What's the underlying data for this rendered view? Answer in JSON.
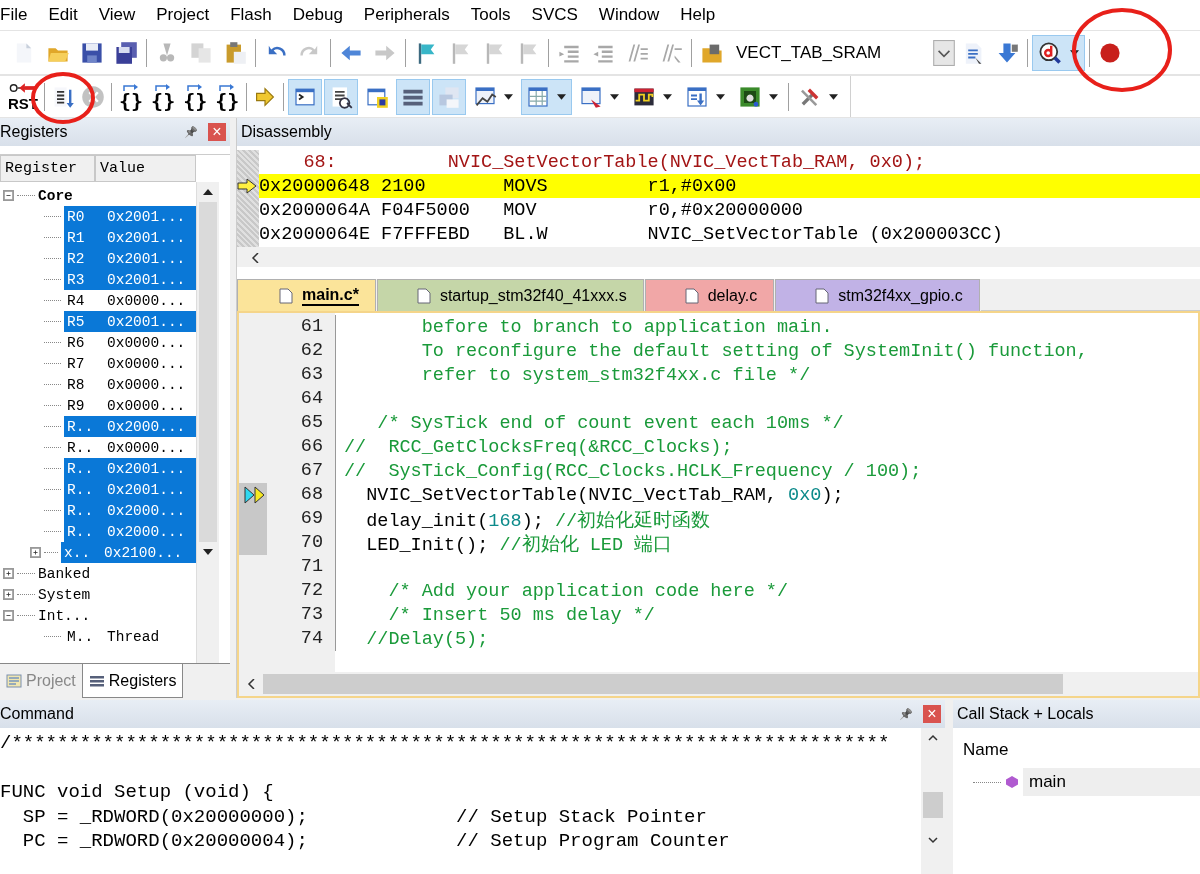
{
  "menu": [
    "File",
    "Edit",
    "View",
    "Project",
    "Flash",
    "Debug",
    "Peripherals",
    "Tools",
    "SVCS",
    "Window",
    "Help"
  ],
  "toolbar": {
    "target": "VECT_TAB_SRAM",
    "debug_on": true
  },
  "debug_toolbar": {
    "reset_label": "RST",
    "step_buttons": [
      "{}",
      "{}",
      "{}",
      "{}"
    ],
    "windows": [
      {
        "on": true
      },
      {
        "on": true
      },
      {
        "on": false
      },
      {
        "on": true
      },
      {
        "on": true
      },
      {
        "on": false
      },
      {
        "on": true
      },
      {
        "on": false
      },
      {
        "on": false
      },
      {
        "on": false
      },
      {
        "on": false
      }
    ]
  },
  "registers_panel": {
    "title": "Registers",
    "pin": "📌",
    "close": "×",
    "columns": [
      "Register",
      "Value"
    ],
    "tree": [
      {
        "name": "Core",
        "expanded": true,
        "children": [
          {
            "name": "R0",
            "value": "0x2001...",
            "selected": true
          },
          {
            "name": "R1",
            "value": "0x2001...",
            "selected": true
          },
          {
            "name": "R2",
            "value": "0x2001...",
            "selected": true
          },
          {
            "name": "R3",
            "value": "0x2001...",
            "selected": true
          },
          {
            "name": "R4",
            "value": "0x0000...",
            "selected": false
          },
          {
            "name": "R5",
            "value": "0x2001...",
            "selected": true
          },
          {
            "name": "R6",
            "value": "0x0000...",
            "selected": false
          },
          {
            "name": "R7",
            "value": "0x0000...",
            "selected": false
          },
          {
            "name": "R8",
            "value": "0x0000...",
            "selected": false
          },
          {
            "name": "R9",
            "value": "0x0000...",
            "selected": false
          },
          {
            "name": "R..",
            "value": "0x2000...",
            "selected": true
          },
          {
            "name": "R..",
            "value": "0x0000...",
            "selected": false
          },
          {
            "name": "R..",
            "value": "0x2001...",
            "selected": true
          },
          {
            "name": "R..",
            "value": "0x2001...",
            "selected": true
          },
          {
            "name": "R..",
            "value": "0x2000...",
            "selected": true
          },
          {
            "name": "R..",
            "value": "0x2000...",
            "selected": true
          },
          {
            "name": "x..",
            "value": "0x2100...",
            "selected": true,
            "expanded": false
          }
        ]
      },
      {
        "name": "Banked",
        "expanded": false
      },
      {
        "name": "System",
        "expanded": false
      },
      {
        "name": "Int...",
        "expanded": true,
        "children": [
          {
            "name": "M..",
            "value": "Thread",
            "selected": false
          }
        ]
      }
    ],
    "tabs": [
      {
        "label": "Project",
        "selected": false
      },
      {
        "label": "Registers",
        "selected": true
      }
    ]
  },
  "disassembly": {
    "title": "Disassembly",
    "lines": [
      {
        "kind": "source",
        "text": "    68:          NVIC_SetVectorTable(NVIC_VectTab_RAM, 0x0);"
      },
      {
        "kind": "current",
        "address": "0x20000648",
        "opcode": "2100",
        "mnemonic": "MOVS",
        "operands": "r1,#0x00"
      },
      {
        "kind": "asm",
        "address": "0x2000064A",
        "opcode": "F04F5000",
        "mnemonic": "MOV",
        "operands": "r0,#0x20000000"
      },
      {
        "kind": "asm",
        "address": "0x2000064E",
        "opcode": "F7FFFEBD",
        "mnemonic": "BL.W",
        "operands": "NVIC_SetVectorTable (0x200003CC)"
      }
    ]
  },
  "editor": {
    "tabs": [
      {
        "label": "main.c*",
        "selected": true,
        "color": "#fbe49a"
      },
      {
        "label": "startup_stm32f40_41xxx.s",
        "selected": false,
        "color": "#c5d6a8"
      },
      {
        "label": "delay.c",
        "selected": false,
        "color": "#f1a7a7"
      },
      {
        "label": "stm32f4xx_gpio.c",
        "selected": false,
        "color": "#c1b2e6"
      }
    ],
    "lines": [
      {
        "num": "61",
        "executed": false,
        "current": false,
        "segments": [
          {
            "kind": "comment",
            "text": "       before to branch to application main."
          }
        ]
      },
      {
        "num": "62",
        "executed": false,
        "current": false,
        "segments": [
          {
            "kind": "comment",
            "text": "       To reconfigure the default setting of SystemInit() function,"
          }
        ]
      },
      {
        "num": "63",
        "executed": false,
        "current": false,
        "segments": [
          {
            "kind": "comment",
            "text": "       refer to system_stm32f4xx.c file */"
          }
        ]
      },
      {
        "num": "64",
        "executed": false,
        "current": false
      },
      {
        "num": "65",
        "executed": false,
        "current": false,
        "segments": [
          {
            "kind": "comment",
            "text": "   /* SysTick end of count event each 10ms */"
          }
        ]
      },
      {
        "num": "66",
        "executed": false,
        "current": false,
        "segments": [
          {
            "kind": "comment",
            "text": "//  RCC_GetClocksFreq(&RCC_Clocks);"
          }
        ]
      },
      {
        "num": "67",
        "executed": false,
        "current": false,
        "segments": [
          {
            "kind": "comment",
            "text": "//  SysTick_Config(RCC_Clocks.HCLK_Frequency / 100);"
          }
        ]
      },
      {
        "num": "68",
        "executed": true,
        "current": true,
        "segments": [
          {
            "kind": "code",
            "text": "  NVIC_SetVectorTable(NVIC_VectTab_RAM, "
          },
          {
            "kind": "number",
            "text": "0x0"
          },
          {
            "kind": "code",
            "text": ");"
          }
        ]
      },
      {
        "num": "69",
        "executed": true,
        "current": false,
        "segments": [
          {
            "kind": "code",
            "text": "  delay_init("
          },
          {
            "kind": "number",
            "text": "168"
          },
          {
            "kind": "code",
            "text": "); "
          },
          {
            "kind": "comment",
            "text": "//初始化延时函数"
          }
        ]
      },
      {
        "num": "70",
        "executed": true,
        "current": false,
        "segments": [
          {
            "kind": "code",
            "text": "  LED_Init(); "
          },
          {
            "kind": "comment",
            "text": "//初始化 LED 端口"
          }
        ]
      },
      {
        "num": "71",
        "executed": false,
        "current": false
      },
      {
        "num": "72",
        "executed": false,
        "current": false,
        "segments": [
          {
            "kind": "comment",
            "text": "    /* Add your application code here */"
          }
        ]
      },
      {
        "num": "73",
        "executed": false,
        "current": false,
        "segments": [
          {
            "kind": "comment",
            "text": "    /* Insert 50 ms delay */"
          }
        ]
      },
      {
        "num": "74",
        "executed": false,
        "current": false,
        "segments": [
          {
            "kind": "comment",
            "text": "  //Delay(5);"
          }
        ]
      }
    ]
  },
  "command_panel": {
    "title": "Command",
    "pin": "📌",
    "close": "×",
    "lines": [
      {
        "text": "/*****************************************************************************"
      },
      {
        "text": "FUNC void Setup (void) {"
      },
      {
        "text": "  SP = _RDWORD(0x20000000);             // Setup Stack Pointer"
      },
      {
        "text": "  PC = _RDWORD(0x20000004);             // Setup Program Counter"
      }
    ]
  },
  "callstack_panel": {
    "title": "Call Stack + Locals",
    "columns": [
      "Name"
    ],
    "rows": [
      {
        "name": "main"
      }
    ]
  }
}
